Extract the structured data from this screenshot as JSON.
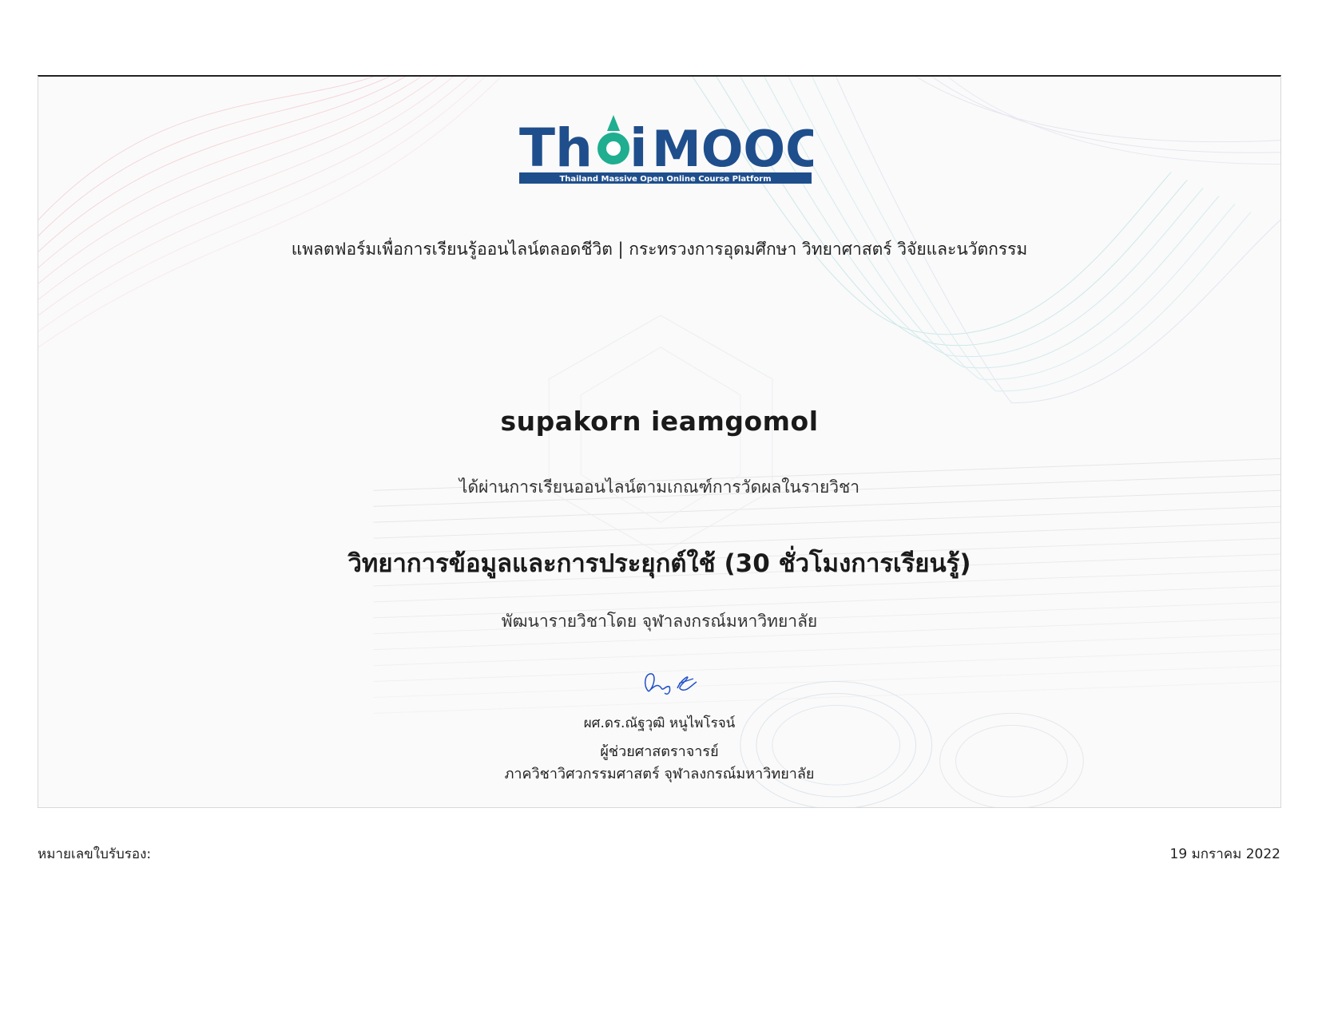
{
  "logo": {
    "wordmark": "Thai MOOC",
    "subtitle": "Thailand Massive Open Online Course Platform",
    "brand_color": "#1f4e8c",
    "accent_color": "#1fae8f"
  },
  "tagline": "แพลตฟอร์มเพื่อการเรียนรู้ออนไลน์ตลอดชีวิต | กระทรวงการอุดมศึกษา วิทยาศาสตร์ วิจัยและนวัตกรรม",
  "recipient_name": "supakorn ieamgomol",
  "passed_text": "ได้ผ่านการเรียนออนไลน์ตามเกณฑ์การวัดผลในรายวิชา",
  "course_title": "วิทยาการข้อมูลและการประยุกต์ใช้ (30 ชั่วโมงการเรียนรู้)",
  "developed_by": "พัฒนารายวิชาโดย จุฬาลงกรณ์มหาวิทยาลัย",
  "signer": {
    "name": "ผศ.ดร.ณัฐวุฒิ หนูไพโรจน์",
    "position": "ผู้ช่วยศาสตราจารย์",
    "department": "ภาควิชาวิศวกรรมศาสตร์ จุฬาลงกรณ์มหาวิทยาลัย"
  },
  "footer": {
    "certificate_number_label": "หมายเลขใบรับรอง:",
    "issue_date": "19 มกราคม 2022"
  }
}
